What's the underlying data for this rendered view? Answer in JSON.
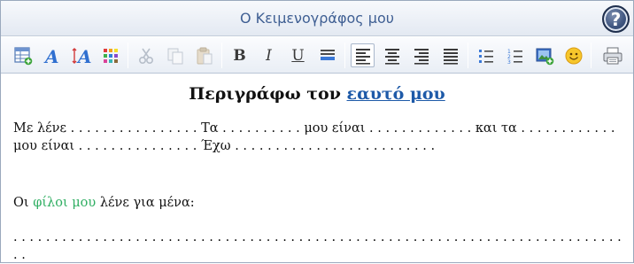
{
  "window": {
    "title": "Ο Κειμενογράφος μου",
    "help_label": "?"
  },
  "toolbar": {
    "buttons": [
      {
        "name": "insert-table-icon"
      },
      {
        "name": "font-style-icon"
      },
      {
        "name": "font-size-icon"
      },
      {
        "name": "color-palette-icon"
      },
      {
        "name": "cut-icon"
      },
      {
        "name": "copy-icon"
      },
      {
        "name": "paste-icon"
      },
      {
        "name": "bold-icon",
        "glyph": "B"
      },
      {
        "name": "italic-icon",
        "glyph": "I"
      },
      {
        "name": "underline-icon",
        "glyph": "U"
      },
      {
        "name": "highlight-icon"
      },
      {
        "name": "align-left-icon"
      },
      {
        "name": "align-center-icon"
      },
      {
        "name": "align-right-icon"
      },
      {
        "name": "align-justify-icon"
      },
      {
        "name": "bullet-list-icon"
      },
      {
        "name": "numbered-list-icon"
      },
      {
        "name": "insert-image-icon"
      },
      {
        "name": "smiley-icon"
      },
      {
        "name": "print-icon"
      }
    ]
  },
  "document": {
    "heading_text": "Περιγράφω τον ",
    "heading_link": "εαυτό μου",
    "line1": "Με λένε . . . . . . . . . . . . . . . . Τα . . . . . . . . . . μου είναι . . . . . . . . . . . . . και τα . . . . . . . . . . . .",
    "line2": "μου είναι . . . . . . . . . . . . . . . Έχω . . . . . . . . . . . . . . . . . . . . . . . . .",
    "friends_pre": "Οι ",
    "friends_green": "φίλοι μου",
    "friends_post": " λένε για μένα:",
    "dots_line": ". . . . . . . . . . . . . . . . . . . . . . . . . . . . . . . . . . . . . . . . . . . . . . . . . . . . . . . . . . . . . . . . . . . . . . . . . . . . ."
  },
  "colors": {
    "title_text": "#3f5f93",
    "link": "#1e5aa8",
    "green_text": "#2fae62"
  }
}
